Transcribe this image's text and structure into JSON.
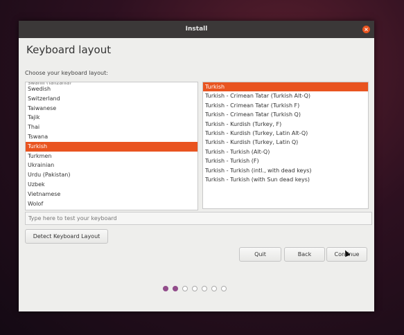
{
  "window": {
    "title": "Install"
  },
  "heading": "Keyboard layout",
  "prompt": "Choose your keyboard layout:",
  "layouts": {
    "cut_item": "Swahili (Tanzania)",
    "items": [
      "Swedish",
      "Switzerland",
      "Taiwanese",
      "Tajik",
      "Thai",
      "Tswana",
      "Turkish",
      "Turkmen",
      "Ukrainian",
      "Urdu (Pakistan)",
      "Uzbek",
      "Vietnamese",
      "Wolof"
    ],
    "selected": "Turkish"
  },
  "variants": {
    "items": [
      "Turkish",
      "Turkish - Crimean Tatar (Turkish Alt-Q)",
      "Turkish - Crimean Tatar (Turkish F)",
      "Turkish - Crimean Tatar (Turkish Q)",
      "Turkish - Kurdish (Turkey, F)",
      "Turkish - Kurdish (Turkey, Latin Alt-Q)",
      "Turkish - Kurdish (Turkey, Latin Q)",
      "Turkish - Turkish (Alt-Q)",
      "Turkish - Turkish (F)",
      "Turkish - Turkish (intl., with dead keys)",
      "Turkish - Turkish (with Sun dead keys)"
    ],
    "selected": "Turkish"
  },
  "test_input": {
    "placeholder": "Type here to test your keyboard"
  },
  "buttons": {
    "detect": "Detect Keyboard Layout",
    "quit": "Quit",
    "back": "Back",
    "continue": "Continue"
  },
  "progress": {
    "total_steps": 7,
    "completed_steps": 2
  },
  "colors": {
    "accent": "#e95420",
    "progress_dot": "#924d8b",
    "titlebar": "#3b3838"
  }
}
